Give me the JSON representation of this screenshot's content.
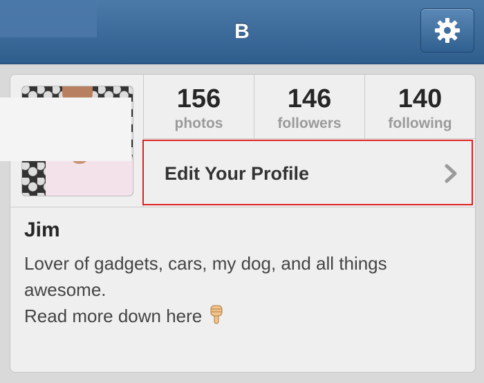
{
  "navbar": {
    "title": "B",
    "settings_icon": "gear-icon"
  },
  "profile": {
    "stats": [
      {
        "value": "156",
        "label": "photos"
      },
      {
        "value": "146",
        "label": "followers"
      },
      {
        "value": "140",
        "label": "following"
      }
    ],
    "edit_label": "Edit Your Profile",
    "edit_icon": "chevron-right-icon",
    "highlight_color": "#e02020"
  },
  "bio": {
    "name": "Jim",
    "line1": "Lover of gadgets, cars, my dog, and all things",
    "line2": "awesome.",
    "line3": "Read more down here",
    "line3_icon": "pointing-down-hand-icon"
  },
  "colors": {
    "navbar": "#3a6a9a",
    "card": "#efefef",
    "background": "#d9d9d9"
  }
}
